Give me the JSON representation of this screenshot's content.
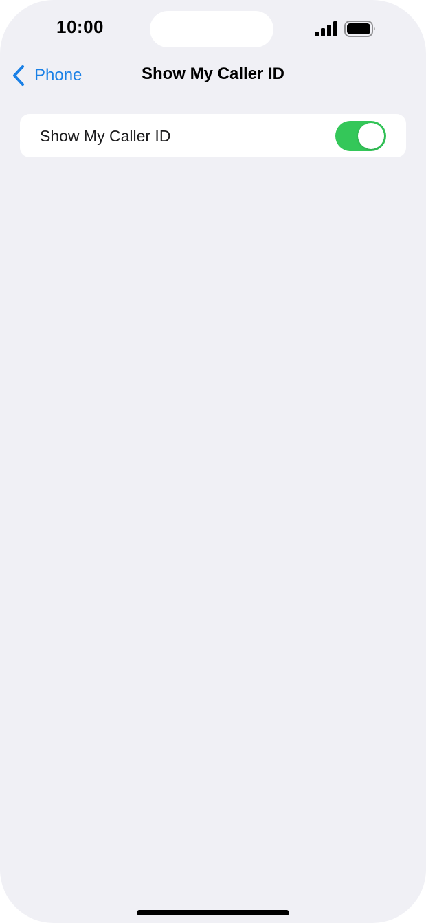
{
  "status_bar": {
    "time": "10:00",
    "signal_icon": "cellular-signal-icon",
    "battery_icon": "battery-icon"
  },
  "nav": {
    "back_label": "Phone",
    "back_icon": "chevron-left-icon",
    "title": "Show My Caller ID"
  },
  "settings": {
    "rows": [
      {
        "label": "Show My Caller ID",
        "toggle_on": true
      }
    ]
  },
  "colors": {
    "accent": "#1a80e6",
    "toggle_on": "#34c759",
    "background": "#f0f0f5",
    "card": "#ffffff"
  }
}
